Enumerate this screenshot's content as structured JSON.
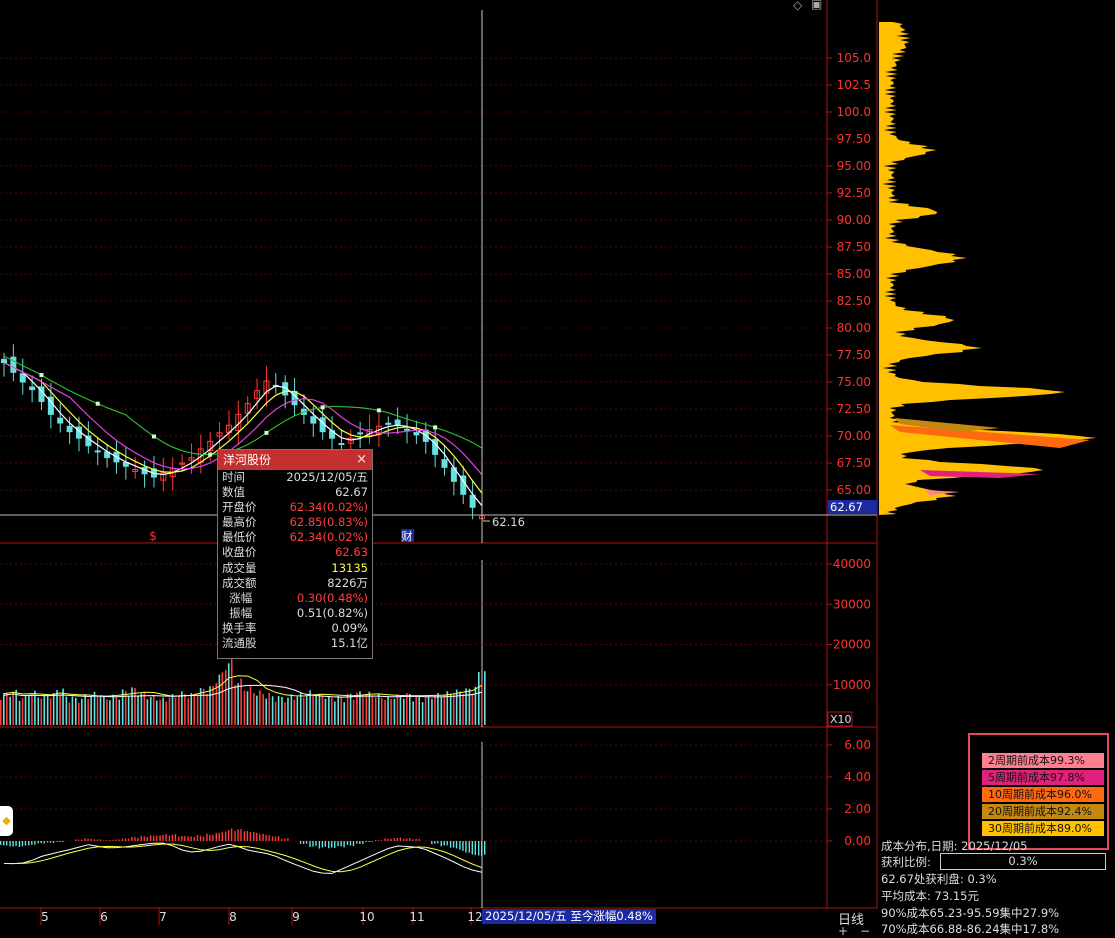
{
  "window_icons": {
    "diamond": "◇",
    "square": "▣"
  },
  "colors": {
    "bg": "#000000",
    "grid": "#5a0000",
    "frame": "#b01515",
    "axis_text": "#ff3030",
    "up": "#ff3b3b",
    "down": "#66e0e0",
    "ma_white": "#ffffff",
    "ma_yellow": "#ffff40",
    "ma_magenta": "#e040e0",
    "ma_green": "#30c030",
    "chip": "#ffc000"
  },
  "tooltip": {
    "title": "洋河股份",
    "close": "×",
    "rows": [
      {
        "k": "时间",
        "v": "2025/12/05/五",
        "color": "#dddddd"
      },
      {
        "k": "数值",
        "v": "62.67",
        "color": "#dddddd"
      },
      {
        "k": "开盘价",
        "v": "62.34(0.02%)",
        "color": "#ff4040"
      },
      {
        "k": "最高价",
        "v": "62.85(0.83%)",
        "color": "#ff4040"
      },
      {
        "k": "最低价",
        "v": "62.34(0.02%)",
        "color": "#ff4040"
      },
      {
        "k": "收盘价",
        "v": "62.63",
        "color": "#ff4040"
      },
      {
        "k": "成交量",
        "v": "13135",
        "color": "#ffff40"
      },
      {
        "k": "成交额",
        "v": "8226万",
        "color": "#dddddd"
      },
      {
        "k": "  涨幅",
        "v": "0.30(0.48%)",
        "color": "#ff4040"
      },
      {
        "k": "  振幅",
        "v": "0.51(0.82%)",
        "color": "#dddddd"
      },
      {
        "k": "换手率",
        "v": "0.09%",
        "color": "#dddddd"
      },
      {
        "k": "流通股",
        "v": "15.1亿",
        "color": "#dddddd"
      }
    ]
  },
  "chart_data": [
    {
      "type": "candlestick",
      "title": "",
      "price_axis": {
        "ylim": [
          63.5,
          107.0
        ],
        "ticks": [
          "65.00",
          "67.50",
          "70.00",
          "72.50",
          "75.00",
          "77.50",
          "80.00",
          "82.50",
          "85.00",
          "87.50",
          "90.00",
          "92.50",
          "95.00",
          "97.50",
          "100.0",
          "102.5",
          "105.0"
        ],
        "current_price_label": "62.67"
      },
      "crosshair_price_label": "62.16",
      "markers": [
        {
          "label": "$",
          "color": "#ff3030"
        },
        {
          "label": "财",
          "color": "#ffffff"
        }
      ],
      "close_series": [
        {
          "name": "",
          "values": [
            76.8,
            75.9,
            75.0,
            74.3,
            73.2,
            72.0,
            71.2,
            70.4,
            69.8,
            69.1,
            68.6,
            68.0,
            67.6,
            67.2,
            66.9,
            66.5,
            66.2,
            66.6,
            67.0,
            67.5,
            68.0,
            68.8,
            69.5,
            70.3,
            71.0,
            72.0,
            73.0,
            74.2,
            75.1,
            74.6,
            73.8,
            72.9,
            72.0,
            71.2,
            70.4,
            69.8,
            69.3,
            69.8,
            70.2,
            70.6,
            70.9,
            71.1,
            71.0,
            70.6,
            70.1,
            69.5,
            68.3,
            67.1,
            65.8,
            64.6,
            63.4,
            62.63
          ]
        }
      ]
    },
    {
      "type": "bar",
      "title": "",
      "axis": {
        "ticks": [
          "10000",
          "20000",
          "30000",
          "40000"
        ],
        "ylim": [
          0,
          45000
        ],
        "multiplier_label": "X10"
      },
      "values": [
        7800,
        8400,
        6900,
        8100,
        7300,
        7600,
        8800,
        7000,
        6600,
        7400,
        7900,
        6800,
        7200,
        8500,
        9100,
        7700,
        7000,
        6500,
        7300,
        8000,
        7600,
        8900,
        9500,
        12600,
        15800,
        11000,
        9200,
        8300,
        7800,
        7100,
        6800,
        7300,
        7600,
        8200,
        7400,
        6900,
        7000,
        7600,
        8100,
        7900,
        7300,
        6800,
        7400,
        7700,
        7200,
        6900,
        7600,
        8000,
        8400,
        8700,
        9200,
        13135
      ]
    },
    {
      "type": "line",
      "title": "",
      "axis": {
        "ticks": [
          "0.00",
          "2.00",
          "4.00",
          "6.00"
        ],
        "ylim": [
          -2.8,
          7.2
        ]
      },
      "macd_values": [
        -0.45,
        -0.55,
        -0.6,
        -0.5,
        -0.3,
        -0.2,
        -0.1,
        0.0,
        0.15,
        0.3,
        0.2,
        0.1,
        0.15,
        0.25,
        0.4,
        0.55,
        0.7,
        0.8,
        0.7,
        0.5,
        0.45,
        0.6,
        0.85,
        1.1,
        1.3,
        1.2,
        1.0,
        0.9,
        0.8,
        0.6,
        0.3,
        0.0,
        -0.3,
        -0.6,
        -0.8,
        -0.9,
        -0.7,
        -0.5,
        -0.3,
        -0.1,
        0.1,
        0.3,
        0.4,
        0.3,
        0.2,
        0.0,
        -0.3,
        -0.6,
        -0.9,
        -1.2,
        -1.4,
        -1.5
      ]
    }
  ],
  "x_dates": [
    "5",
    "6",
    "7",
    "8",
    "9",
    "10",
    "11",
    "12"
  ],
  "crosshair_date": "2025/12/05/五",
  "since_change": "至今涨幅0.48%",
  "period_button": "日线",
  "zoom_plus": "+",
  "zoom_minus": "−",
  "chip_legend": [
    {
      "label": "2周期前成本99.3%",
      "color": "#ff8090"
    },
    {
      "label": "5周期前成本97.8%",
      "color": "#e0207a"
    },
    {
      "label": "10周期前成本96.0%",
      "color": "#ff6a10"
    },
    {
      "label": "20周期前成本92.4%",
      "color": "#c48810"
    },
    {
      "label": "30周期前成本89.0%",
      "color": "#ffc000"
    }
  ],
  "chip_info": {
    "date_line": "成本分布,日期: 2025/12/05",
    "profit_label": "获利比例:",
    "profit_value": "0.3%",
    "profit_at": "62.67处获利盘: 0.3%",
    "avg_cost": "平均成本: 73.15元",
    "c90": "90%成本65.23-95.59集中27.9%",
    "c70": "70%成本66.88-86.24集中17.8%"
  }
}
